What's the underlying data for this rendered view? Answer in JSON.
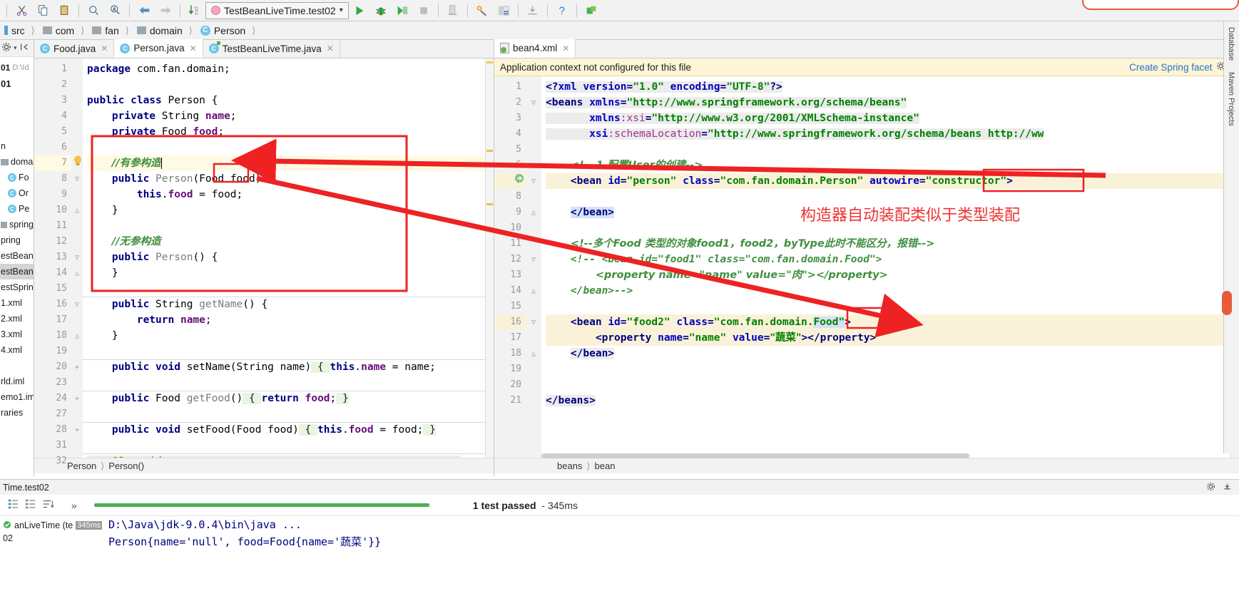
{
  "toolbar": {
    "icons": [
      "cut-icon",
      "copy-icon",
      "paste-icon",
      "find-icon",
      "replace-icon",
      "back-icon",
      "forward-icon",
      "compare-icon"
    ],
    "run_config": "TestBeanLiveTime.test02",
    "run_label": "Run",
    "debug_label": "Debug",
    "coverage_label": "Run with Coverage",
    "stop_label": "Stop",
    "actions": [
      "run-icon",
      "debug-icon",
      "coverage-icon",
      "stop-icon",
      "app-icon",
      "settings-icon",
      "structure-icon",
      "download-icon",
      "help-icon",
      "share-icon"
    ]
  },
  "breadcrumb": {
    "items": [
      {
        "label": "src",
        "icon": "source-root-icon"
      },
      {
        "label": "com",
        "icon": "folder-icon"
      },
      {
        "label": "fan",
        "icon": "folder-icon"
      },
      {
        "label": "domain",
        "icon": "folder-icon"
      },
      {
        "label": "Person",
        "icon": "class-icon"
      }
    ]
  },
  "project_tree": {
    "items": [
      {
        "label": "01",
        "sub": "D:\\Id"
      },
      {
        "label": "01"
      },
      {
        "label": "n"
      },
      {
        "label": "doma"
      },
      {
        "label": "Fo"
      },
      {
        "label": "Or"
      },
      {
        "label": "Pe"
      },
      {
        "label": "spring"
      },
      {
        "label": "pring"
      },
      {
        "label": "estBean"
      },
      {
        "label": "estBean"
      },
      {
        "label": "estSprin"
      },
      {
        "label": "1.xml"
      },
      {
        "label": "2.xml"
      },
      {
        "label": "3.xml"
      },
      {
        "label": "4.xml"
      },
      {
        "label": "rld.iml"
      },
      {
        "label": "emo1.im"
      },
      {
        "label": "raries"
      }
    ]
  },
  "left_editor": {
    "tabs": [
      {
        "label": "Food.java",
        "icon": "java-class-icon",
        "active": false
      },
      {
        "label": "Person.java",
        "icon": "java-class-icon",
        "active": true
      },
      {
        "label": "TestBeanLiveTime.java",
        "icon": "java-test-class-icon",
        "active": false
      }
    ],
    "line_numbers": [
      "1",
      "2",
      "3",
      "4",
      "5",
      "6",
      "7",
      "8",
      "9",
      "10",
      "11",
      "12",
      "13",
      "14",
      "15",
      "16",
      "17",
      "18",
      "19",
      "20",
      "23",
      "24",
      "27",
      "28",
      "31",
      "32"
    ],
    "code_lines": [
      "package com.fan.domain;",
      "",
      "public class Person {",
      "    private String name;",
      "    private Food food;",
      "",
      "    //有参构造",
      "    public Person(Food food) {",
      "        this.food = food;",
      "    }",
      "",
      "    //无参构造",
      "    public Person() {",
      "    }",
      "",
      "    public String getName() {",
      "        return name;",
      "    }",
      "",
      "    public void setName(String name) { this.name = name;",
      "",
      "    public Food getFood() { return food; }",
      "",
      "    public void setFood(Food food) { this.food = food; }",
      "",
      "    @Override"
    ],
    "breadcrumb": [
      "Person",
      "Person()"
    ]
  },
  "right_editor": {
    "tabs": [
      {
        "label": "bean4.xml",
        "icon": "xml-spring-icon",
        "active": true
      }
    ],
    "notice": {
      "message": "Application context not configured for this file",
      "action": "Create Spring facet",
      "gear": "gear-icon"
    },
    "line_numbers": [
      "1",
      "2",
      "3",
      "4",
      "5",
      "6",
      "7",
      "8",
      "9",
      "10",
      "11",
      "12",
      "13",
      "14",
      "15",
      "16",
      "17",
      "18",
      "19",
      "20",
      "21"
    ],
    "code_lines": [
      "<?xml version=\"1.0\" encoding=\"UTF-8\"?>",
      "<beans xmlns=\"http://www.springframework.org/schema/beans\"",
      "       xmlns:xsi=\"http://www.w3.org/2001/XMLSchema-instance\"",
      "       xsi:schemaLocation=\"http://www.springframework.org/schema/beans http://ww",
      "",
      "    <!-- 1.配置User的创建-->",
      "    <bean id=\"person\" class=\"com.fan.domain.Person\" autowire=\"constructor\">",
      "",
      "    </bean>",
      "",
      "    <!--多个Food 类型的对象food1，food2，byType此时不能区分，报错-->",
      "    <!-- <bean id=\"food1\" class=\"com.fan.domain.Food\">",
      "        <property name=\"name\" value=\"肉\"></property>",
      "    </bean>-->",
      "",
      "    <bean id=\"food2\" class=\"com.fan.domain.Food\">",
      "        <property name=\"name\" value=\"蔬菜\"></property>",
      "    </bean>",
      "",
      "",
      "</beans>"
    ],
    "breadcrumb": [
      "beans",
      "bean"
    ]
  },
  "annotation": {
    "text": "构造器自动装配类似于类型装配",
    "color": "#ee3333"
  },
  "right_tool_strip": {
    "items": [
      "Database",
      "Maven Projects"
    ]
  },
  "run_panel": {
    "title": "Time.test02",
    "toolbar_icons": [
      "expand-all-icon",
      "collapse-all-icon",
      "sort-icon",
      "more-icon"
    ],
    "test_node": "anLiveTime (te",
    "test_node_time": "345ms",
    "test_sub": "02",
    "status_text": "1 test passed",
    "status_time": "- 345ms",
    "console_lines": [
      "D:\\Java\\jdk-9.0.4\\bin\\java ...",
      "Person{name='null', food=Food{name='蔬菜'}}"
    ],
    "settings_icons": [
      "gear-icon",
      "minimize-icon"
    ]
  },
  "colors": {
    "accent": "#2a6fc9",
    "annotation_red": "#ee2222",
    "pass_green": "#4caf50",
    "notice_bg": "#fdf5d6"
  }
}
